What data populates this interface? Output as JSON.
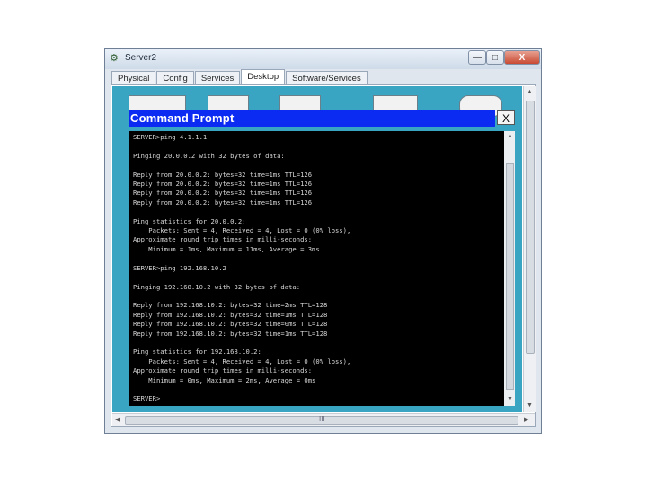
{
  "window": {
    "title": "Server2",
    "controls": {
      "minimize": "—",
      "maximize": "□",
      "close": "X"
    }
  },
  "tabs": [
    {
      "label": "Physical",
      "active": false
    },
    {
      "label": "Config",
      "active": false
    },
    {
      "label": "Services",
      "active": false
    },
    {
      "label": "Desktop",
      "active": true
    },
    {
      "label": "Software/Services",
      "active": false
    }
  ],
  "command_prompt": {
    "title": "Command Prompt",
    "close_label": "X",
    "lines": [
      "SERVER>ping 4.1.1.1",
      "",
      "Pinging 20.0.0.2 with 32 bytes of data:",
      "",
      "Reply from 20.0.0.2: bytes=32 time=1ms TTL=126",
      "Reply from 20.0.0.2: bytes=32 time=1ms TTL=126",
      "Reply from 20.0.0.2: bytes=32 time=1ms TTL=126",
      "Reply from 20.0.0.2: bytes=32 time=1ms TTL=126",
      "",
      "Ping statistics for 20.0.0.2:",
      "    Packets: Sent = 4, Received = 4, Lost = 0 (0% loss),",
      "Approximate round trip times in milli-seconds:",
      "    Minimum = 1ms, Maximum = 11ms, Average = 3ms",
      "",
      "SERVER>ping 192.168.10.2",
      "",
      "Pinging 192.168.10.2 with 32 bytes of data:",
      "",
      "Reply from 192.168.10.2: bytes=32 time=2ms TTL=128",
      "Reply from 192.168.10.2: bytes=32 time=1ms TTL=128",
      "Reply from 192.168.10.2: bytes=32 time=0ms TTL=128",
      "Reply from 192.168.10.2: bytes=32 time=1ms TTL=128",
      "",
      "Ping statistics for 192.168.10.2:",
      "    Packets: Sent = 4, Received = 4, Lost = 0 (0% loss),",
      "Approximate round trip times in milli-seconds:",
      "    Minimum = 0ms, Maximum = 2ms, Average = 0ms",
      "",
      "SERVER>"
    ]
  },
  "icons": {
    "app": "server-icon",
    "desktop": [
      "ip-configuration-icon",
      "dial-up-icon",
      "terminal-icon",
      "command-prompt-icon",
      "web-browser-icon"
    ]
  },
  "colors": {
    "desktop_background": "#3aa5c2",
    "cmd_titlebar": "#0b2bf2",
    "terminal_background": "#000000",
    "terminal_text": "#d6d6d6"
  },
  "scroll": {
    "grip": "III"
  }
}
